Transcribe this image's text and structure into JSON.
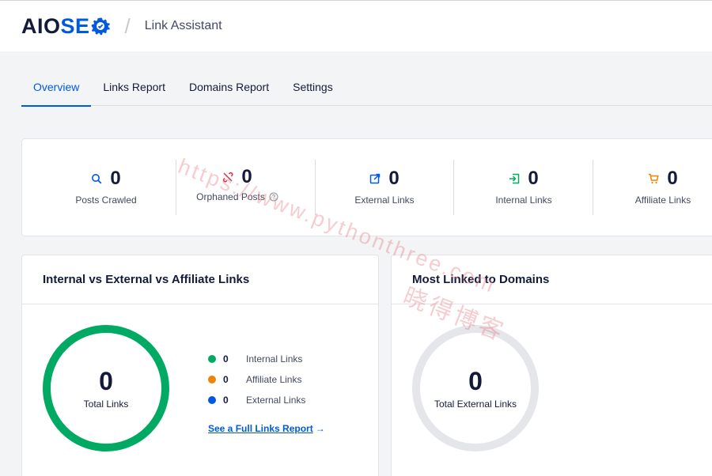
{
  "header": {
    "logo_aio": "AIO",
    "logo_seo_s": "S",
    "logo_seo_e": "E",
    "separator": "/",
    "page_name": "Link Assistant"
  },
  "tabs": [
    {
      "label": "Overview",
      "active": true
    },
    {
      "label": "Links Report",
      "active": false
    },
    {
      "label": "Domains Report",
      "active": false
    },
    {
      "label": "Settings",
      "active": false
    }
  ],
  "stats": [
    {
      "label": "Posts Crawled",
      "value": "0",
      "icon": "search-icon",
      "color": "#005ae0"
    },
    {
      "label": "Orphaned Posts",
      "value": "0",
      "icon": "broken-link-icon",
      "color": "#df2a4a"
    },
    {
      "label": "External Links",
      "value": "0",
      "icon": "external-link-icon",
      "color": "#005ae0"
    },
    {
      "label": "Internal Links",
      "value": "0",
      "icon": "internal-link-icon",
      "color": "#00aa63"
    },
    {
      "label": "Affiliate Links",
      "value": "0",
      "icon": "cart-icon",
      "color": "#f18200"
    }
  ],
  "links_panel": {
    "title": "Internal vs External vs Affiliate Links",
    "total_value": "0",
    "total_label": "Total Links",
    "ring_color": "#00aa63",
    "legend": [
      {
        "label": "Internal Links",
        "value": "0",
        "color": "#00aa63"
      },
      {
        "label": "Affiliate Links",
        "value": "0",
        "color": "#f18200"
      },
      {
        "label": "External Links",
        "value": "0",
        "color": "#005ae0"
      }
    ],
    "report_link": "See a Full Links Report",
    "report_arrow": "→"
  },
  "domains_panel": {
    "title": "Most Linked to Domains",
    "total_value": "0",
    "total_label": "Total External Links",
    "ring_color": "#e5e6ea"
  },
  "watermark": {
    "line1": "https://www.pythonthree.com",
    "line2": "晓得博客"
  }
}
